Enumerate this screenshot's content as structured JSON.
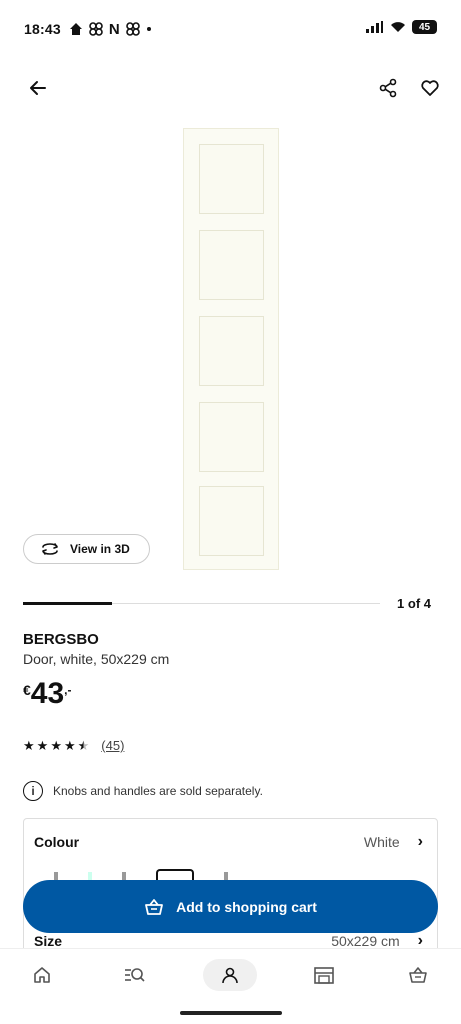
{
  "status_bar": {
    "time": "18:43",
    "notif_letter": "N",
    "battery": "45"
  },
  "carousel": {
    "counter": "1 of 4",
    "progress": 0.25
  },
  "view3d": {
    "label": "View in 3D"
  },
  "product": {
    "name": "BERGSBO",
    "description": "Door, white, 50x229 cm",
    "price": {
      "currency": "€",
      "amount": "43",
      "decimals": ",-"
    },
    "rating": {
      "stars": 4.5,
      "reviews": "(45)"
    },
    "notice": "Knobs and handles are sold separately."
  },
  "options": {
    "colour_label": "Colour",
    "colour_value": "White",
    "size_label": "Size",
    "size_value": "50x229 cm"
  },
  "cart": {
    "label": "Add to shopping cart"
  },
  "colors": {
    "accent": "#0058a3"
  },
  "icons": [
    "back-arrow-icon",
    "share-icon",
    "heart-icon",
    "rotate-3d-icon",
    "info-icon",
    "basket-icon",
    "home-icon",
    "search-icon",
    "profile-icon",
    "store-icon"
  ]
}
